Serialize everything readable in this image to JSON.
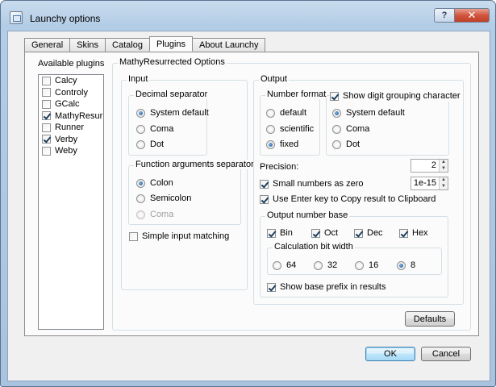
{
  "window": {
    "title": "Launchy options",
    "help_label": "?",
    "close_label": "✕"
  },
  "tabs": [
    {
      "label": "General",
      "active": false
    },
    {
      "label": "Skins",
      "active": false
    },
    {
      "label": "Catalog",
      "active": false
    },
    {
      "label": "Plugins",
      "active": true
    },
    {
      "label": "About Launchy",
      "active": false
    }
  ],
  "plugins": {
    "label": "Available plugins",
    "items": [
      {
        "label": "Calcy",
        "checked": false
      },
      {
        "label": "Controly",
        "checked": false
      },
      {
        "label": "GCalc",
        "checked": false
      },
      {
        "label": "MathyResurrec",
        "checked": true
      },
      {
        "label": "Runner",
        "checked": false
      },
      {
        "label": "Verby",
        "checked": true
      },
      {
        "label": "Weby",
        "checked": false
      }
    ]
  },
  "options": {
    "title": "MathyResurrected Options",
    "input": {
      "label": "Input",
      "decimal_separator": {
        "label": "Decimal separator",
        "options": [
          "System default",
          "Coma",
          "Dot"
        ],
        "selected": "System default"
      },
      "function_separator": {
        "label": "Function arguments separator",
        "options": [
          "Colon",
          "Semicolon",
          "Coma"
        ],
        "selected": "Colon",
        "disabled": "Coma"
      },
      "simple_input_matching": {
        "label": "Simple input matching",
        "checked": false
      }
    },
    "output": {
      "label": "Output",
      "number_format": {
        "label": "Number format",
        "options": [
          "default",
          "scientific",
          "fixed"
        ],
        "selected": "fixed"
      },
      "digit_grouping": {
        "label": "Show digit grouping character",
        "checked": true,
        "options": [
          "System default",
          "Coma",
          "Dot"
        ],
        "selected": "System default"
      },
      "precision": {
        "label": "Precision:",
        "value": "2"
      },
      "small_numbers": {
        "label": "Small numbers as zero",
        "checked": true,
        "value": "1e-15"
      },
      "use_enter": {
        "label": "Use Enter key to Copy result to Clipboard",
        "checked": true
      },
      "number_base": {
        "label": "Output number base",
        "bases": [
          {
            "label": "Bin",
            "checked": true
          },
          {
            "label": "Oct",
            "checked": true
          },
          {
            "label": "Dec",
            "checked": true
          },
          {
            "label": "Hex",
            "checked": true
          }
        ],
        "bit_width": {
          "label": "Calculation bit width",
          "options": [
            "64",
            "32",
            "16",
            "8"
          ],
          "selected": "8"
        },
        "show_prefix": {
          "label": "Show base prefix in results",
          "checked": true
        }
      }
    },
    "defaults_label": "Defaults"
  },
  "footer": {
    "ok_label": "OK",
    "cancel_label": "Cancel"
  }
}
